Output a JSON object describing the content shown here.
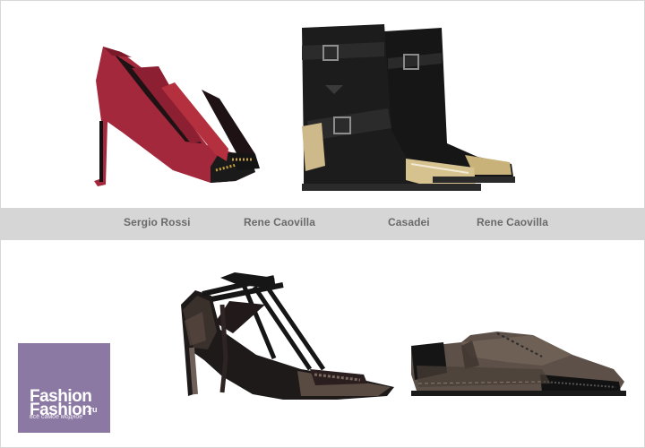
{
  "brands": {
    "top_left": "Sergio Rossi",
    "top_center_left": "Rene Caovilla",
    "top_center_right": "Casadei",
    "top_right": "Rene Caovilla"
  },
  "logo": {
    "line1": "Fashion",
    "line2": "Fashion",
    "domain": ".ru",
    "tagline": "всё самое модное"
  },
  "colors": {
    "band": "#d6d6d6",
    "logo_bg": "#8c79a3",
    "pump_red": "#a3283b"
  },
  "icons": [
    "red-pump-image",
    "black-boot-image",
    "t-strap-heel-image",
    "lace-oxford-image"
  ]
}
